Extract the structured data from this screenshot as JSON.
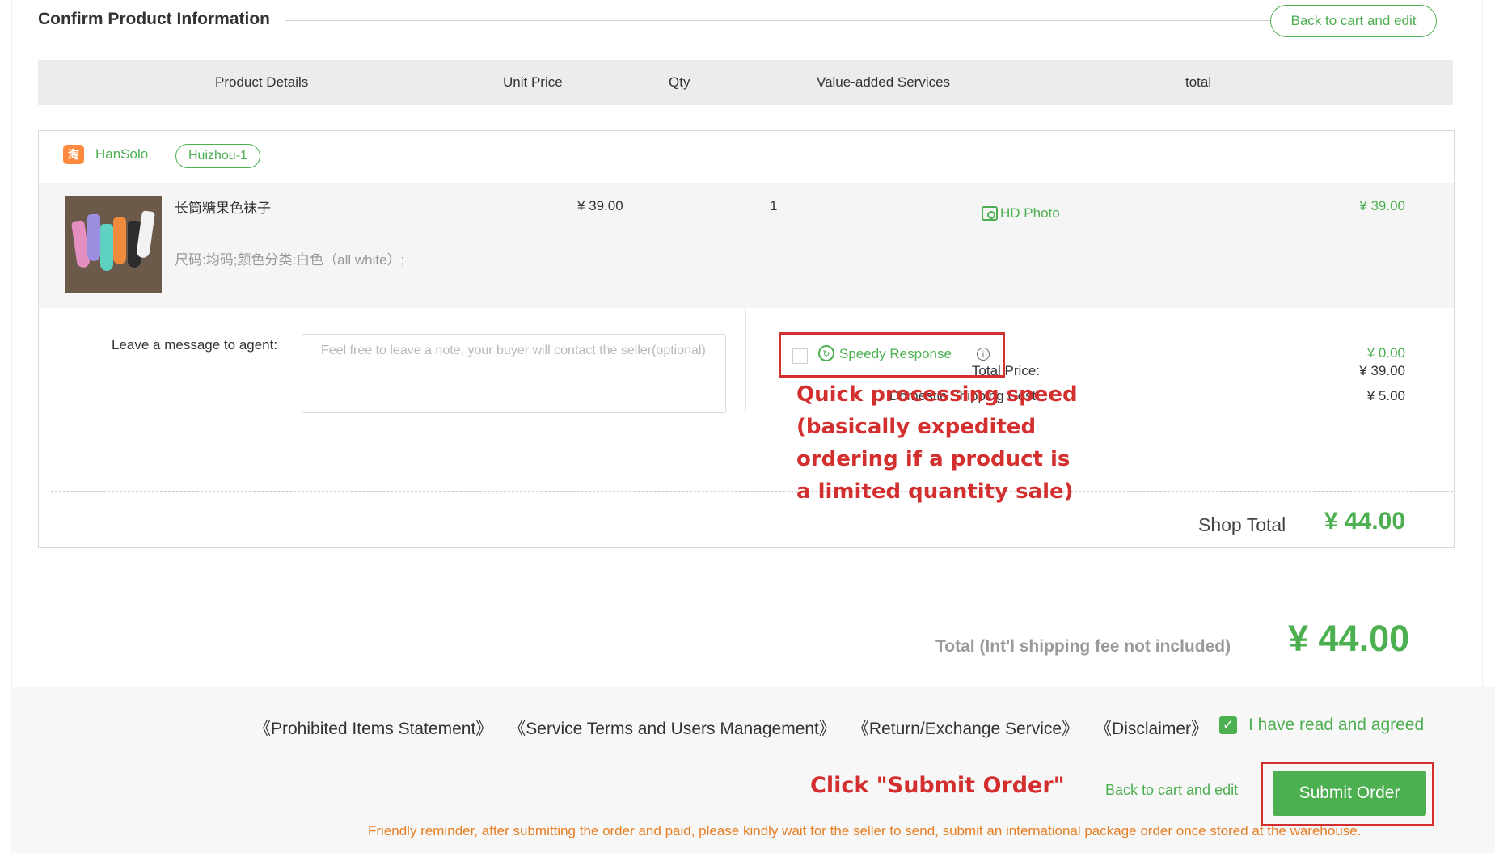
{
  "header": {
    "title": "Confirm Product Information",
    "back_label": "Back to cart and edit"
  },
  "table_head": {
    "details": "Product Details",
    "unit_price": "Unit Price",
    "qty": "Qty",
    "services": "Value-added Services",
    "total": "total"
  },
  "shop": {
    "platform_icon_glyph": "淘",
    "seller": "HanSolo",
    "warehouse": "Huizhou-1",
    "item": {
      "name": "长筒糖果色袜子",
      "attributes": "尺码:均码;颜色分类:白色（all white）;",
      "unit_price": "¥ 39.00",
      "qty": "1",
      "hd_photo": "HD Photo",
      "total": "¥ 39.00"
    },
    "message": {
      "label": "Leave a message to agent:",
      "placeholder": "Feel free to leave a note, your buyer will contact the seller(optional)",
      "value": ""
    },
    "speedy": {
      "label": "Speedy Response",
      "checked": false,
      "price": "¥ 0.00"
    },
    "summary": {
      "total_price_label": "Total Price:",
      "total_price": "¥ 39.00",
      "domestic_label": "Domestic Shipping Cost:",
      "domestic": "¥ 5.00",
      "shop_total_label": "Shop Total",
      "shop_total": "¥ 44.00"
    }
  },
  "annotations": {
    "speedy_note": "Quick processing speed (basically expedited ordering if a product is a limited quantity sale)",
    "submit_note": "Click \"Submit Order\""
  },
  "grand_total": {
    "label": "Total (Int'l shipping fee not included)",
    "value": "¥ 44.00"
  },
  "footer": {
    "links": [
      "《Prohibited Items Statement》",
      "《Service Terms and Users Management》",
      "《Return/Exchange Service》",
      "《Disclaimer》"
    ],
    "agree_label": "I have read and agreed",
    "agree_checked": true,
    "back_label": "Back to cart and edit",
    "submit_label": "Submit Order",
    "reminder": "Friendly reminder, after submitting the order and paid, please kindly wait for the seller to send, submit an international package order once stored at the warehouse."
  },
  "colors": {
    "accent_green": "#4caf50",
    "annotation_red": "#d32f2f",
    "reminder_orange": "#e67e22"
  }
}
